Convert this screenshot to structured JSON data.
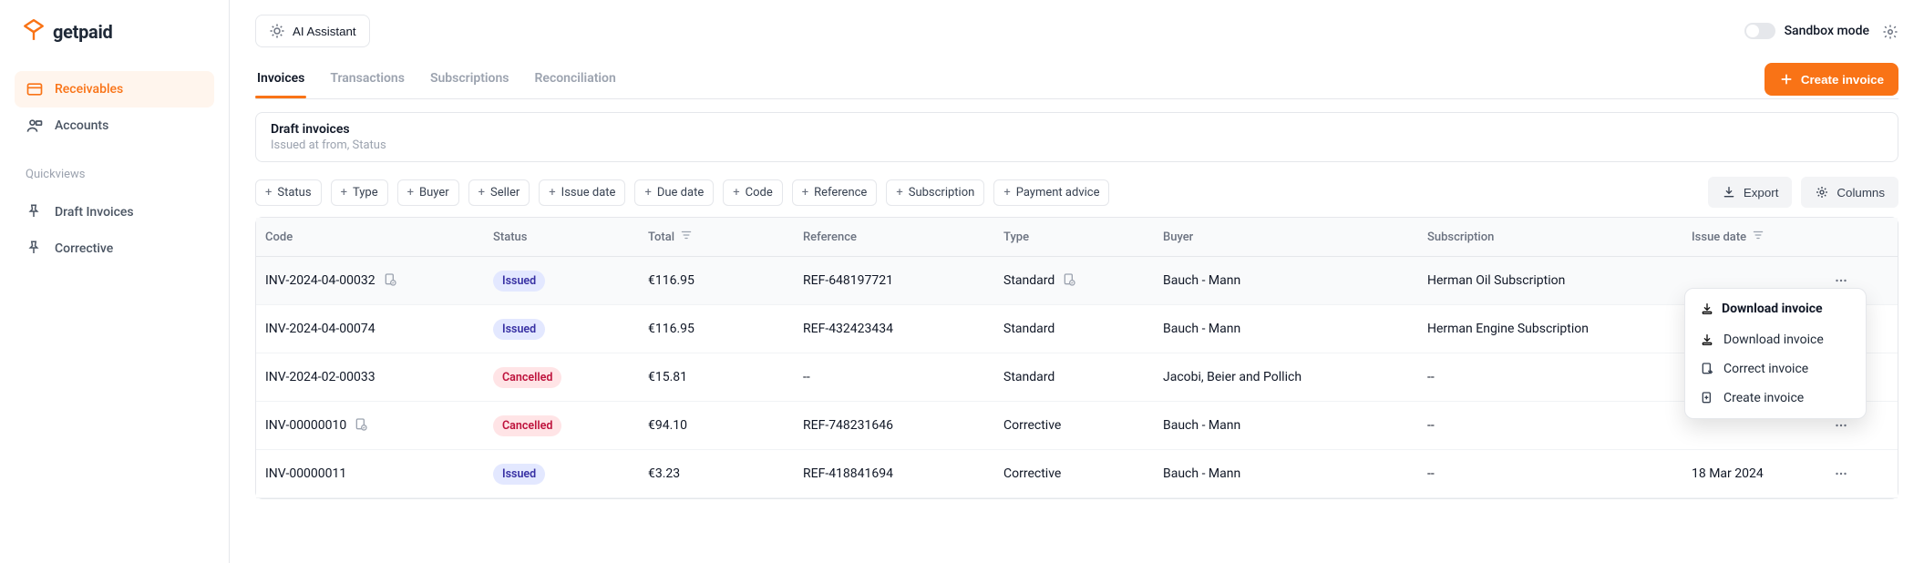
{
  "brand": "getpaid",
  "topbar": {
    "ai_label": "AI Assistant",
    "sandbox_label": "Sandbox mode"
  },
  "sidebar": {
    "items": [
      {
        "label": "Receivables",
        "active": true
      },
      {
        "label": "Accounts",
        "active": false
      }
    ],
    "quickviews_label": "Quickviews",
    "quickviews": [
      {
        "label": "Draft Invoices"
      },
      {
        "label": "Corrective"
      }
    ]
  },
  "primary_action": {
    "label": "Create invoice"
  },
  "tabs": [
    {
      "label": "Invoices",
      "active": true
    },
    {
      "label": "Transactions"
    },
    {
      "label": "Subscriptions"
    },
    {
      "label": "Reconciliation"
    }
  ],
  "filtercard": {
    "title": "Draft invoices",
    "subtitle": "Issued at from, Status"
  },
  "chips": [
    "Status",
    "Type",
    "Buyer",
    "Seller",
    "Issue date",
    "Due date",
    "Code",
    "Reference",
    "Subscription",
    "Payment advice"
  ],
  "toolbar": {
    "export": "Export",
    "columns": "Columns"
  },
  "columns": [
    "Code",
    "Status",
    "Total",
    "Reference",
    "Type",
    "Buyer",
    "Subscription",
    "Issue date"
  ],
  "rows": [
    {
      "code": "INV-2024-04-00032",
      "status": "Issued",
      "status_kind": "issued",
      "total": "€116.95",
      "reference": "REF-648197721",
      "type": "Standard",
      "type_icon": true,
      "buyer": "Bauch - Mann",
      "subscription": "Herman Oil Subscription",
      "issue": "",
      "code_icon": true,
      "menu_open": true
    },
    {
      "code": "INV-2024-04-00074",
      "status": "Issued",
      "status_kind": "issued",
      "total": "€116.95",
      "reference": "REF-432423434",
      "type": "Standard",
      "buyer": "Bauch - Mann",
      "subscription": "Herman Engine Subscription",
      "issue": ""
    },
    {
      "code": "INV-2024-02-00033",
      "status": "Cancelled",
      "status_kind": "cancelled",
      "total": "€15.81",
      "reference": "--",
      "type": "Standard",
      "buyer": "Jacobi, Beier and Pollich",
      "subscription": "--",
      "issue": ""
    },
    {
      "code": "INV-00000010",
      "status": "Cancelled",
      "status_kind": "cancelled",
      "total": "€94.10",
      "reference": "REF-748231646",
      "type": "Corrective",
      "buyer": "Bauch - Mann",
      "subscription": "--",
      "issue": "",
      "code_icon": true
    },
    {
      "code": "INV-00000011",
      "status": "Issued",
      "status_kind": "issued",
      "total": "€3.23",
      "reference": "REF-418841694",
      "type": "Corrective",
      "buyer": "Bauch - Mann",
      "subscription": "--",
      "issue": "18 Mar 2024"
    }
  ],
  "dropdown": {
    "header": "Download invoice",
    "items": [
      "Download invoice",
      "Correct invoice",
      "Create invoice"
    ]
  }
}
